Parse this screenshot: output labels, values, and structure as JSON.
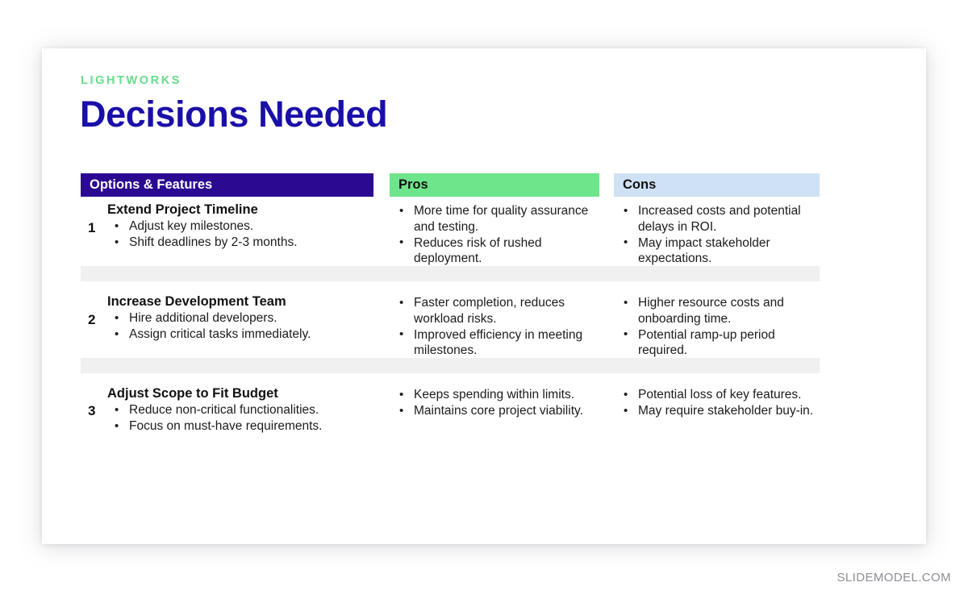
{
  "slide": {
    "eyebrow": "LIGHTWORKS",
    "title": "Decisions Needed",
    "footer_brand": "SLIDEMODEL.COM"
  },
  "colors": {
    "accent_green": "#6ee58a",
    "eyebrow_green": "#66dd8a",
    "title_navy": "#1a0fa8",
    "header_navy": "#2b0a91",
    "header_blue_light": "#cfe2f5",
    "separator_grey": "#f0f0f0",
    "footer_grey": "#8e8e96"
  },
  "table": {
    "headers": {
      "options": "Options & Features",
      "pros": "Pros",
      "cons": "Cons"
    },
    "rows": [
      {
        "number": "1",
        "option_title": "Extend Project Timeline",
        "option_bullets": [
          "Adjust key milestones.",
          "Shift deadlines by 2-3 months."
        ],
        "pros": [
          "More time for quality assurance and testing.",
          "Reduces risk of rushed deployment."
        ],
        "cons": [
          "Increased costs and potential delays in ROI.",
          "May impact stakeholder expectations."
        ]
      },
      {
        "number": "2",
        "option_title": "Increase Development Team",
        "option_bullets": [
          "Hire additional developers.",
          "Assign critical tasks immediately."
        ],
        "pros": [
          "Faster completion, reduces workload risks.",
          "Improved efficiency in meeting milestones."
        ],
        "cons": [
          "Higher resource costs and onboarding time.",
          "Potential ramp-up period required."
        ]
      },
      {
        "number": "3",
        "option_title": "Adjust Scope to Fit Budget",
        "option_bullets": [
          "Reduce non-critical functionalities.",
          "Focus on must-have requirements."
        ],
        "pros": [
          "Keeps spending within limits.",
          "Maintains core project viability."
        ],
        "cons": [
          "Potential loss of key features.",
          "May require stakeholder buy-in."
        ]
      }
    ]
  }
}
